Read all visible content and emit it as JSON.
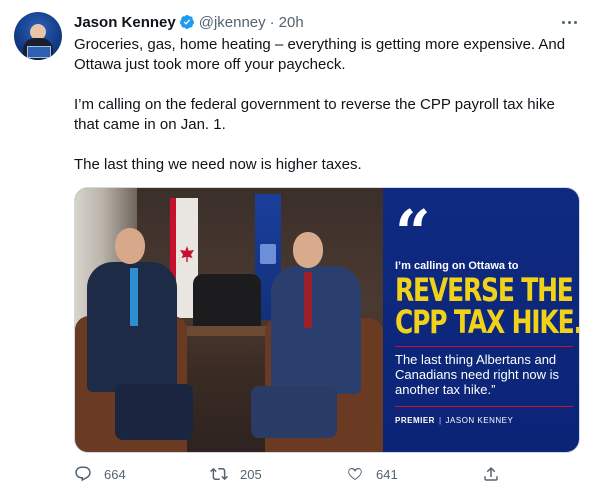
{
  "author": {
    "name": "Jason Kenney",
    "handle": "@jkenney",
    "separator": "·",
    "time": "20h",
    "verified": true
  },
  "tweet": {
    "paragraphs": [
      "Groceries, gas, home heating – everything is getting more expensive. And Ottawa just took more off your paycheck.",
      "I’m calling on the federal government to reverse the CPP payroll tax hike that came in on Jan. 1.",
      "The last thing we need now is higher taxes."
    ]
  },
  "media": {
    "quote_glyph": "“",
    "calling": "I’m calling on Ottawa to",
    "headline_line1": "REVERSE THE",
    "headline_line2": "CPP TAX HIKE.",
    "quote": "The last thing Albertans and Canadians need right now is another tax hike.”",
    "premier_title": "PREMIER",
    "premier_separator": "|",
    "premier_name": "JASON KENNEY",
    "colors": {
      "panel": "#0f2a82",
      "headline": "#f0d21a",
      "rule": "#c8102e"
    }
  },
  "actions": {
    "reply_count": "664",
    "retweet_count": "205",
    "like_count": "641"
  },
  "icons": {
    "verified": "verified-badge-icon",
    "more": "more-icon",
    "reply": "reply-icon",
    "retweet": "retweet-icon",
    "like": "heart-icon",
    "share": "share-icon"
  },
  "colors": {
    "accent": "#1d9bf0",
    "secondary_text": "#536471",
    "text": "#0f1419"
  }
}
